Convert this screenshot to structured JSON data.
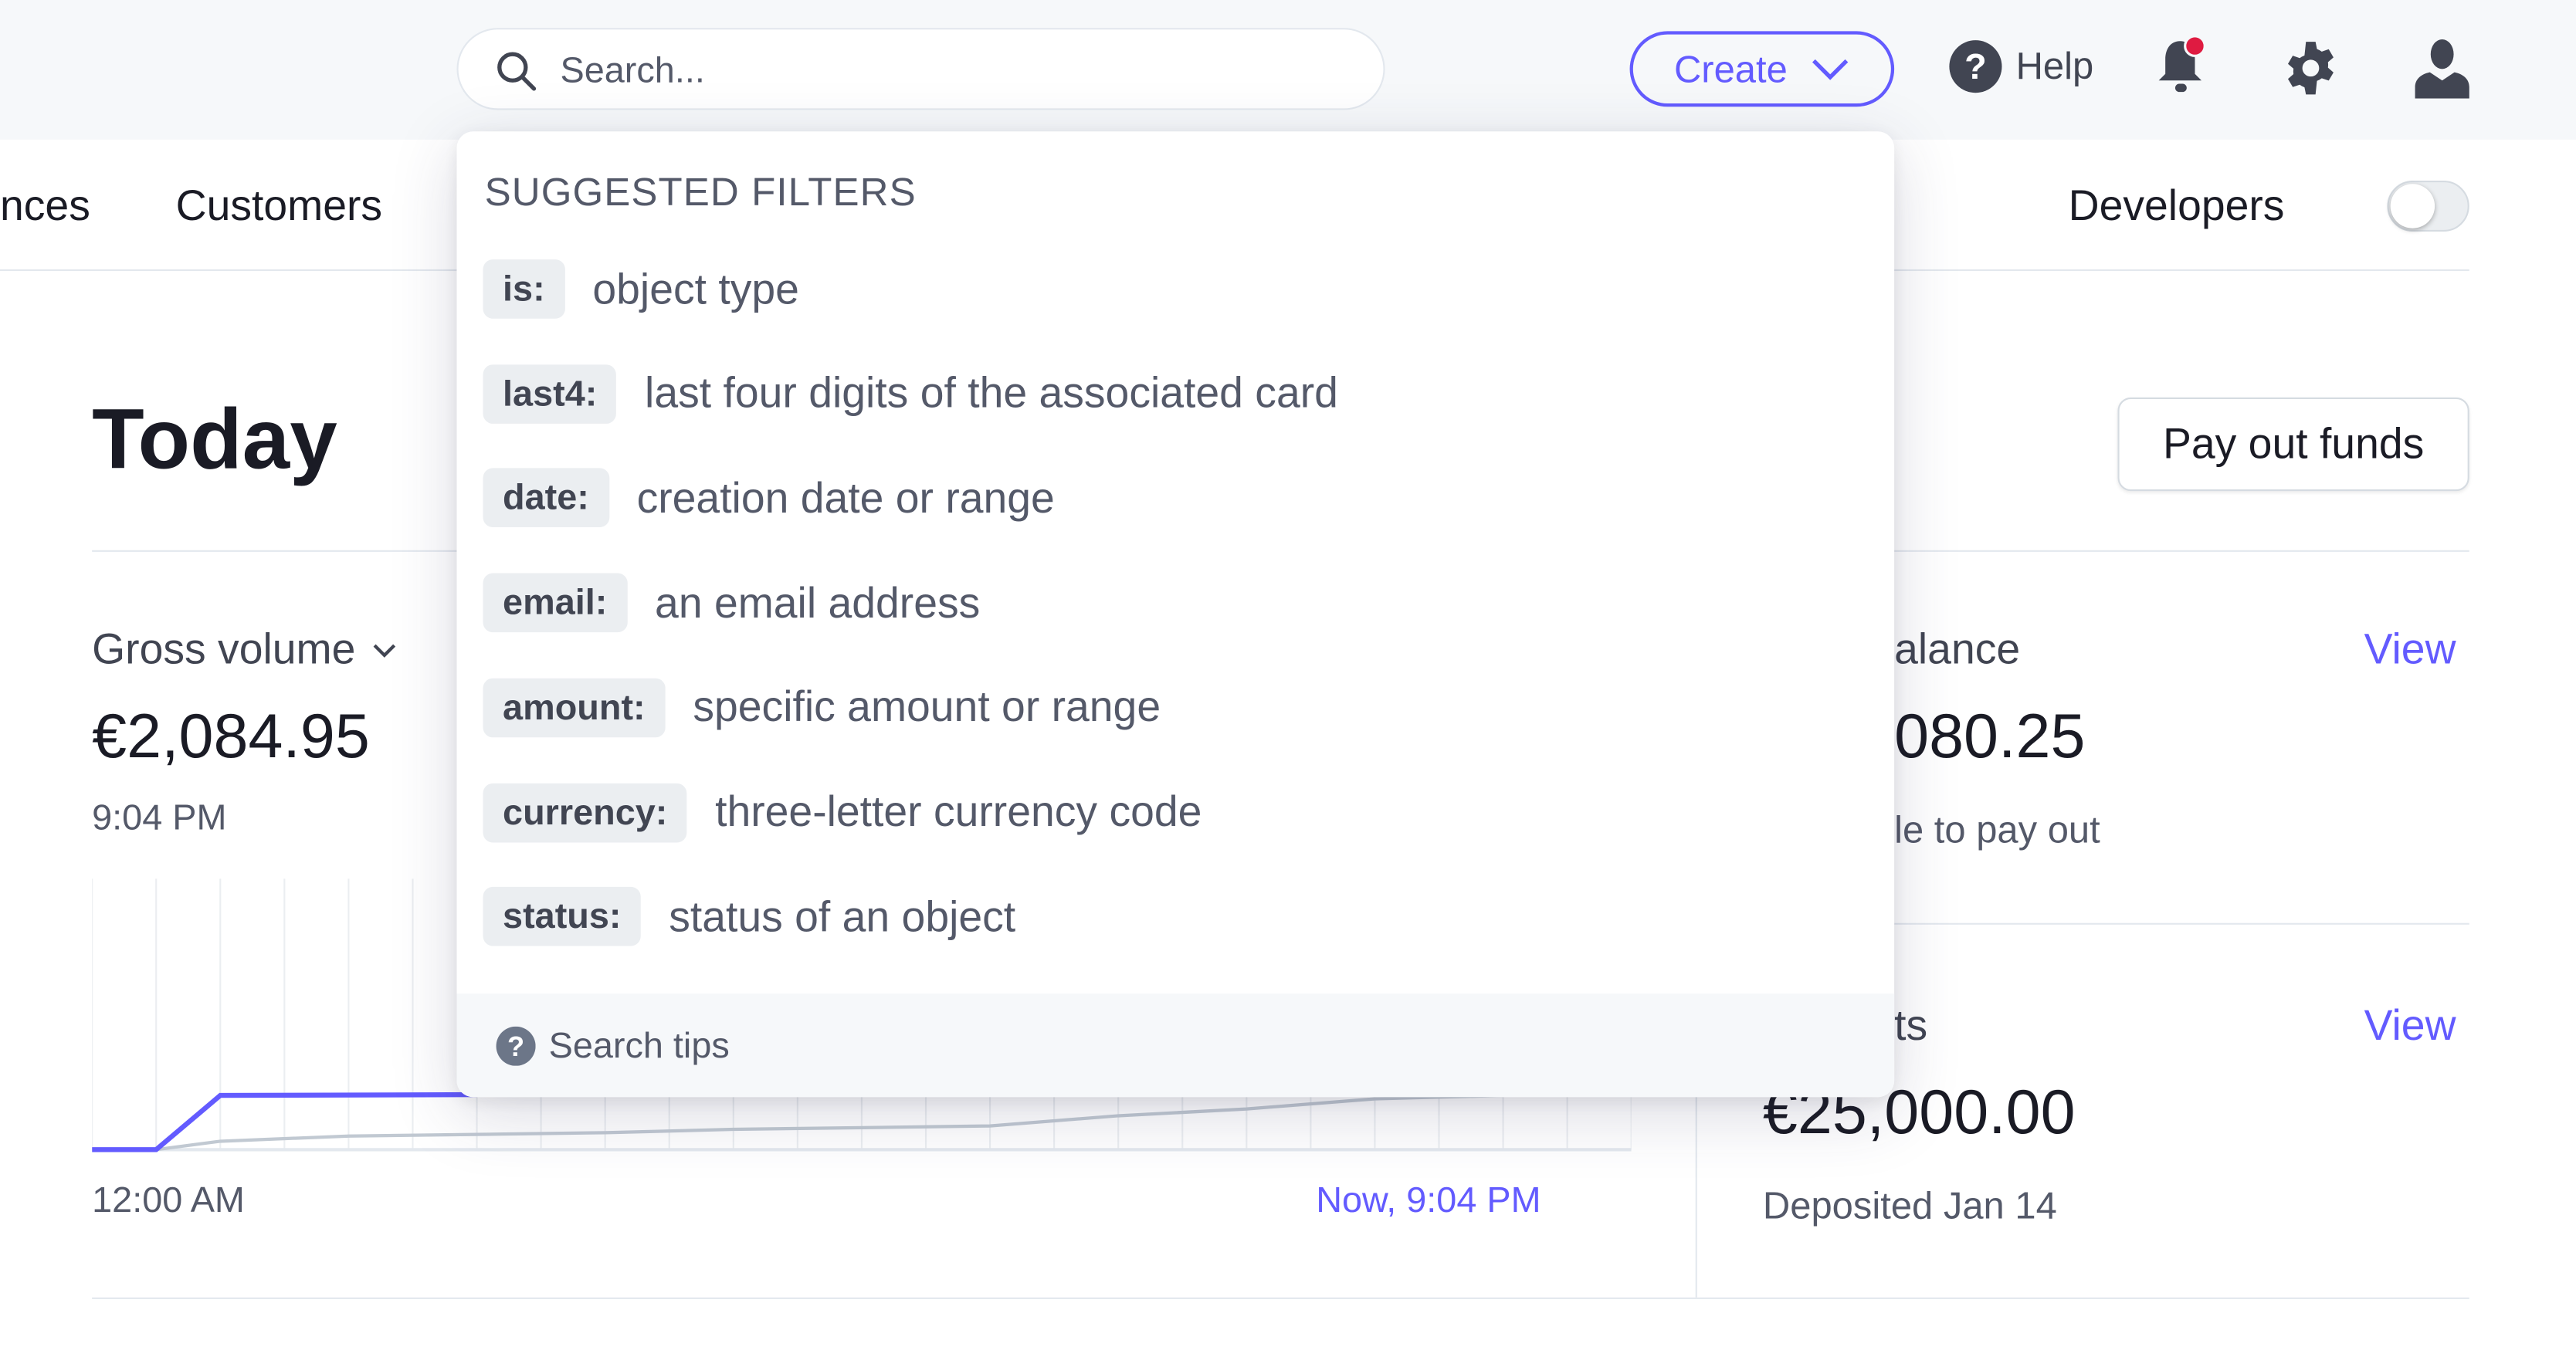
{
  "topbar": {
    "search_placeholder": "Search...",
    "create_label": "Create",
    "help_label": "Help"
  },
  "nav": {
    "items": [
      "nces",
      "Customers"
    ],
    "developers_label": "Developers",
    "developers_toggle_on": false
  },
  "page": {
    "title": "Today",
    "payout_button": "Pay out funds"
  },
  "gross": {
    "label": "Gross volume",
    "value": "€2,084.95",
    "time": "9:04 PM",
    "x_start": "12:00 AM",
    "x_end": "Now, 9:04 PM"
  },
  "balance": {
    "label": "alance",
    "value": "080.25",
    "sub": "le to pay out",
    "view": "View"
  },
  "payouts": {
    "label": "ts",
    "value": "€25,000.00",
    "sub": "Deposited Jan 14",
    "view": "View"
  },
  "dropdown": {
    "title": "SUGGESTED FILTERS",
    "filters": [
      {
        "key": "is:",
        "desc": "object type"
      },
      {
        "key": "last4:",
        "desc": "last four digits of the associated card"
      },
      {
        "key": "date:",
        "desc": "creation date or range"
      },
      {
        "key": "email:",
        "desc": "an email address"
      },
      {
        "key": "amount:",
        "desc": "specific amount or range"
      },
      {
        "key": "currency:",
        "desc": "three-letter currency code"
      },
      {
        "key": "status:",
        "desc": "status of an object"
      }
    ],
    "footer": "Search tips"
  },
  "colors": {
    "accent": "#635bff",
    "notification": "#df1b41",
    "comparison_line": "#c1c9d2"
  },
  "chart_data": {
    "type": "line",
    "x_unit": "hour",
    "xlim": [
      0,
      24
    ],
    "ylim": [
      0,
      10000
    ],
    "grid": "vertical",
    "x_labels": [
      "12:00 AM",
      "Now, 9:04 PM"
    ],
    "series": [
      {
        "color": "#635bff",
        "points": [
          [
            0,
            0
          ],
          [
            1,
            0
          ],
          [
            2,
            2000
          ],
          [
            6,
            2030
          ]
        ]
      },
      {
        "color": "#c1c9d2",
        "points": [
          [
            1,
            0
          ],
          [
            2,
            310
          ],
          [
            4,
            500
          ],
          [
            8,
            625
          ],
          [
            10,
            750
          ],
          [
            12,
            810
          ],
          [
            14,
            875
          ],
          [
            16,
            1250
          ],
          [
            18,
            1500
          ],
          [
            20,
            1875
          ],
          [
            22,
            2000
          ]
        ]
      }
    ]
  }
}
